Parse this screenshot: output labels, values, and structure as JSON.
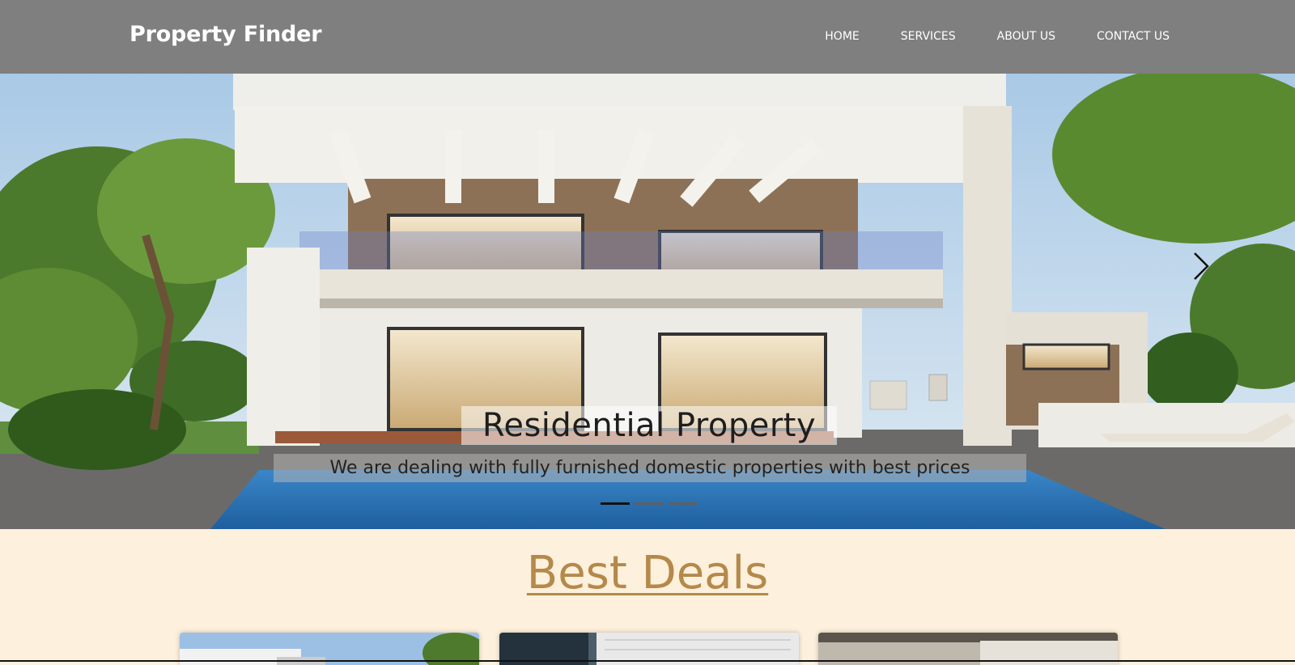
{
  "header": {
    "brand": "Property Finder",
    "nav": [
      "HOME",
      "SERVICES",
      "ABOUT US",
      "CONTACT US"
    ]
  },
  "hero": {
    "slide_title": "Residential Property",
    "slide_text": "We are dealing with fully furnished domestic properties with best prices",
    "next_icon": "chevron-right-icon",
    "slide_count": 3,
    "active_slide": 1
  },
  "deals": {
    "title": "Best Deals"
  },
  "colors": {
    "header_bg": "#7f7f7f",
    "page_bg": "#fdf0dc",
    "deals_title": "#b4894a"
  }
}
